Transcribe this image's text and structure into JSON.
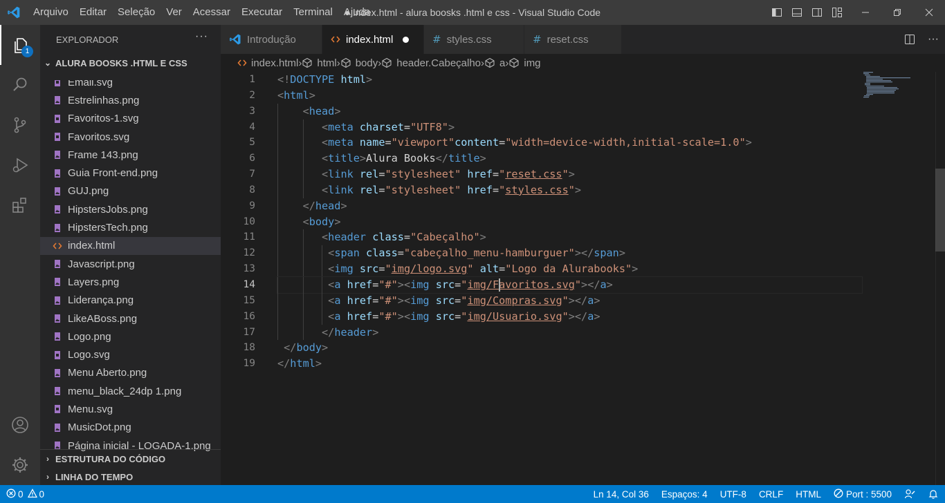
{
  "menu": [
    "Arquivo",
    "Editar",
    "Seleção",
    "Ver",
    "Acessar",
    "Executar",
    "Terminal",
    "Ajuda"
  ],
  "window_title": "● index.html - alura boosks .html e css - Visual Studio Code",
  "explorer": {
    "title": "EXPLORADOR",
    "more": "···",
    "folder_title": "ALURA BOOSKS .HTML E CSS",
    "files": [
      {
        "name": "Email.svg",
        "type": "svg"
      },
      {
        "name": "Estrelinhas.png",
        "type": "png"
      },
      {
        "name": "Favoritos-1.svg",
        "type": "svg"
      },
      {
        "name": "Favoritos.svg",
        "type": "svg"
      },
      {
        "name": "Frame 143.png",
        "type": "png"
      },
      {
        "name": "Guia Front-end.png",
        "type": "png"
      },
      {
        "name": "GUJ.png",
        "type": "png"
      },
      {
        "name": "HipstersJobs.png",
        "type": "png"
      },
      {
        "name": "HipstersTech.png",
        "type": "png"
      },
      {
        "name": "index.html",
        "type": "html"
      },
      {
        "name": "Javascript.png",
        "type": "png"
      },
      {
        "name": "Layers.png",
        "type": "png"
      },
      {
        "name": "Liderança.png",
        "type": "png"
      },
      {
        "name": "LikeABoss.png",
        "type": "png"
      },
      {
        "name": "Logo.png",
        "type": "png"
      },
      {
        "name": "Logo.svg",
        "type": "svg"
      },
      {
        "name": "Menu Aberto.png",
        "type": "png"
      },
      {
        "name": "menu_black_24dp 1.png",
        "type": "png"
      },
      {
        "name": "Menu.svg",
        "type": "svg"
      },
      {
        "name": "MusicDot.png",
        "type": "png"
      },
      {
        "name": "Página inicial - LOGADA-1.png",
        "type": "png"
      }
    ],
    "selected_file": "index.html",
    "outline_title": "ESTRUTURA DO CÓDIGO",
    "timeline_title": "LINHA DO TEMPO"
  },
  "source_control_badge": "1",
  "tabs": [
    {
      "label": "Introdução",
      "icon": "vscode-icon",
      "active": false
    },
    {
      "label": "index.html",
      "icon": "html-icon",
      "active": true,
      "dirty": true
    },
    {
      "label": "styles.css",
      "icon": "css-icon",
      "active": false
    },
    {
      "label": "reset.css",
      "icon": "css-icon",
      "active": false
    }
  ],
  "breadcrumb": [
    "index.html",
    "html",
    "body",
    "header.Cabeçalho",
    "a",
    "img"
  ],
  "editor": {
    "current_line": 14,
    "lines": [
      [
        [
          "br",
          "<!"
        ],
        [
          "tag",
          "DOCTYPE"
        ],
        [
          "txt",
          " "
        ],
        [
          "attr",
          "html"
        ],
        [
          "br",
          ">"
        ]
      ],
      [
        [
          "br",
          "<"
        ],
        [
          "tag",
          "html"
        ],
        [
          "br",
          ">"
        ]
      ],
      [
        [
          "txt",
          "    "
        ],
        [
          "br",
          "<"
        ],
        [
          "tag",
          "head"
        ],
        [
          "br",
          ">"
        ]
      ],
      [
        [
          "txt",
          "       "
        ],
        [
          "br",
          "<"
        ],
        [
          "tag",
          "meta"
        ],
        [
          "txt",
          " "
        ],
        [
          "attr",
          "charset"
        ],
        [
          "txt",
          "="
        ],
        [
          "str",
          "\"UTF8\""
        ],
        [
          "br",
          ">"
        ]
      ],
      [
        [
          "txt",
          "       "
        ],
        [
          "br",
          "<"
        ],
        [
          "tag",
          "meta"
        ],
        [
          "txt",
          " "
        ],
        [
          "attr",
          "name"
        ],
        [
          "txt",
          "="
        ],
        [
          "str",
          "\"viewport\""
        ],
        [
          "attr",
          "content"
        ],
        [
          "txt",
          "="
        ],
        [
          "str",
          "\"width=device-width,initial-scale=1.0\""
        ],
        [
          "br",
          ">"
        ]
      ],
      [
        [
          "txt",
          "       "
        ],
        [
          "br",
          "<"
        ],
        [
          "tag",
          "title"
        ],
        [
          "br",
          ">"
        ],
        [
          "txt",
          "Alura Books"
        ],
        [
          "br",
          "</"
        ],
        [
          "tag",
          "title"
        ],
        [
          "br",
          ">"
        ]
      ],
      [
        [
          "txt",
          "       "
        ],
        [
          "br",
          "<"
        ],
        [
          "tag",
          "link"
        ],
        [
          "txt",
          " "
        ],
        [
          "attr",
          "rel"
        ],
        [
          "txt",
          "="
        ],
        [
          "str",
          "\"stylesheet\""
        ],
        [
          "txt",
          " "
        ],
        [
          "attr",
          "href"
        ],
        [
          "txt",
          "="
        ],
        [
          "str",
          "\""
        ],
        [
          "link",
          "reset.css"
        ],
        [
          "str",
          "\""
        ],
        [
          "br",
          ">"
        ]
      ],
      [
        [
          "txt",
          "       "
        ],
        [
          "br",
          "<"
        ],
        [
          "tag",
          "link"
        ],
        [
          "txt",
          " "
        ],
        [
          "attr",
          "rel"
        ],
        [
          "txt",
          "="
        ],
        [
          "str",
          "\"stylesheet\""
        ],
        [
          "txt",
          " "
        ],
        [
          "attr",
          "href"
        ],
        [
          "txt",
          "="
        ],
        [
          "str",
          "\""
        ],
        [
          "link",
          "styles.css"
        ],
        [
          "str",
          "\""
        ],
        [
          "br",
          ">"
        ]
      ],
      [
        [
          "txt",
          "    "
        ],
        [
          "br",
          "</"
        ],
        [
          "tag",
          "head"
        ],
        [
          "br",
          ">"
        ]
      ],
      [
        [
          "txt",
          "    "
        ],
        [
          "br",
          "<"
        ],
        [
          "tag",
          "body"
        ],
        [
          "br",
          ">"
        ]
      ],
      [
        [
          "txt",
          "       "
        ],
        [
          "br",
          "<"
        ],
        [
          "tag",
          "header"
        ],
        [
          "txt",
          " "
        ],
        [
          "attr",
          "class"
        ],
        [
          "txt",
          "="
        ],
        [
          "str",
          "\"Cabeçalho\""
        ],
        [
          "br",
          ">"
        ]
      ],
      [
        [
          "txt",
          "        "
        ],
        [
          "br",
          "<"
        ],
        [
          "tag",
          "span"
        ],
        [
          "txt",
          " "
        ],
        [
          "attr",
          "class"
        ],
        [
          "txt",
          "="
        ],
        [
          "str",
          "\"cabeçalho_menu-hamburguer\""
        ],
        [
          "br",
          "></"
        ],
        [
          "tag",
          "span"
        ],
        [
          "br",
          ">"
        ]
      ],
      [
        [
          "txt",
          "        "
        ],
        [
          "br",
          "<"
        ],
        [
          "tag",
          "img"
        ],
        [
          "txt",
          " "
        ],
        [
          "attr",
          "src"
        ],
        [
          "txt",
          "="
        ],
        [
          "str",
          "\""
        ],
        [
          "link",
          "img/logo.svg"
        ],
        [
          "str",
          "\""
        ],
        [
          "txt",
          " "
        ],
        [
          "attr",
          "alt"
        ],
        [
          "txt",
          "="
        ],
        [
          "str",
          "\"Logo da Alurabooks\""
        ],
        [
          "br",
          ">"
        ]
      ],
      [
        [
          "txt",
          "        "
        ],
        [
          "br",
          "<"
        ],
        [
          "tag",
          "a"
        ],
        [
          "txt",
          " "
        ],
        [
          "attr",
          "href"
        ],
        [
          "txt",
          "="
        ],
        [
          "str",
          "\"#\""
        ],
        [
          "br",
          "><"
        ],
        [
          "tag",
          "img"
        ],
        [
          "txt",
          " "
        ],
        [
          "attr",
          "src"
        ],
        [
          "txt",
          "="
        ],
        [
          "str",
          "\""
        ],
        [
          "link",
          "img/Favoritos.svg"
        ],
        [
          "str",
          "\""
        ],
        [
          "br",
          "></"
        ],
        [
          "tag",
          "a"
        ],
        [
          "br",
          ">"
        ]
      ],
      [
        [
          "txt",
          "        "
        ],
        [
          "br",
          "<"
        ],
        [
          "tag",
          "a"
        ],
        [
          "txt",
          " "
        ],
        [
          "attr",
          "href"
        ],
        [
          "txt",
          "="
        ],
        [
          "str",
          "\"#\""
        ],
        [
          "br",
          "><"
        ],
        [
          "tag",
          "img"
        ],
        [
          "txt",
          " "
        ],
        [
          "attr",
          "src"
        ],
        [
          "txt",
          "="
        ],
        [
          "str",
          "\""
        ],
        [
          "link",
          "img/Compras.svg"
        ],
        [
          "str",
          "\""
        ],
        [
          "br",
          "></"
        ],
        [
          "tag",
          "a"
        ],
        [
          "br",
          ">"
        ]
      ],
      [
        [
          "txt",
          "        "
        ],
        [
          "br",
          "<"
        ],
        [
          "tag",
          "a"
        ],
        [
          "txt",
          " "
        ],
        [
          "attr",
          "href"
        ],
        [
          "txt",
          "="
        ],
        [
          "str",
          "\"#\""
        ],
        [
          "br",
          "><"
        ],
        [
          "tag",
          "img"
        ],
        [
          "txt",
          " "
        ],
        [
          "attr",
          "src"
        ],
        [
          "txt",
          "="
        ],
        [
          "str",
          "\""
        ],
        [
          "link",
          "img/Usuario.svg"
        ],
        [
          "str",
          "\""
        ],
        [
          "br",
          "></"
        ],
        [
          "tag",
          "a"
        ],
        [
          "br",
          ">"
        ]
      ],
      [
        [
          "txt",
          "       "
        ],
        [
          "br",
          "</"
        ],
        [
          "tag",
          "header"
        ],
        [
          "br",
          ">"
        ]
      ],
      [
        [
          "txt",
          " "
        ],
        [
          "br",
          "</"
        ],
        [
          "tag",
          "body"
        ],
        [
          "br",
          ">"
        ]
      ],
      [
        [
          "br",
          "</"
        ],
        [
          "tag",
          "html"
        ],
        [
          "br",
          ">"
        ]
      ]
    ]
  },
  "status": {
    "errors": "0",
    "warnings": "0",
    "position": "Ln 14, Col 36",
    "indent": "Espaços: 4",
    "encoding": "UTF-8",
    "eol": "CRLF",
    "language": "HTML",
    "port": "Port : 5500"
  },
  "colors": {
    "statusbar": "#007acc",
    "html_icon": "#e37933",
    "svg_icon": "#a074c4",
    "css_icon": "#519aba"
  }
}
